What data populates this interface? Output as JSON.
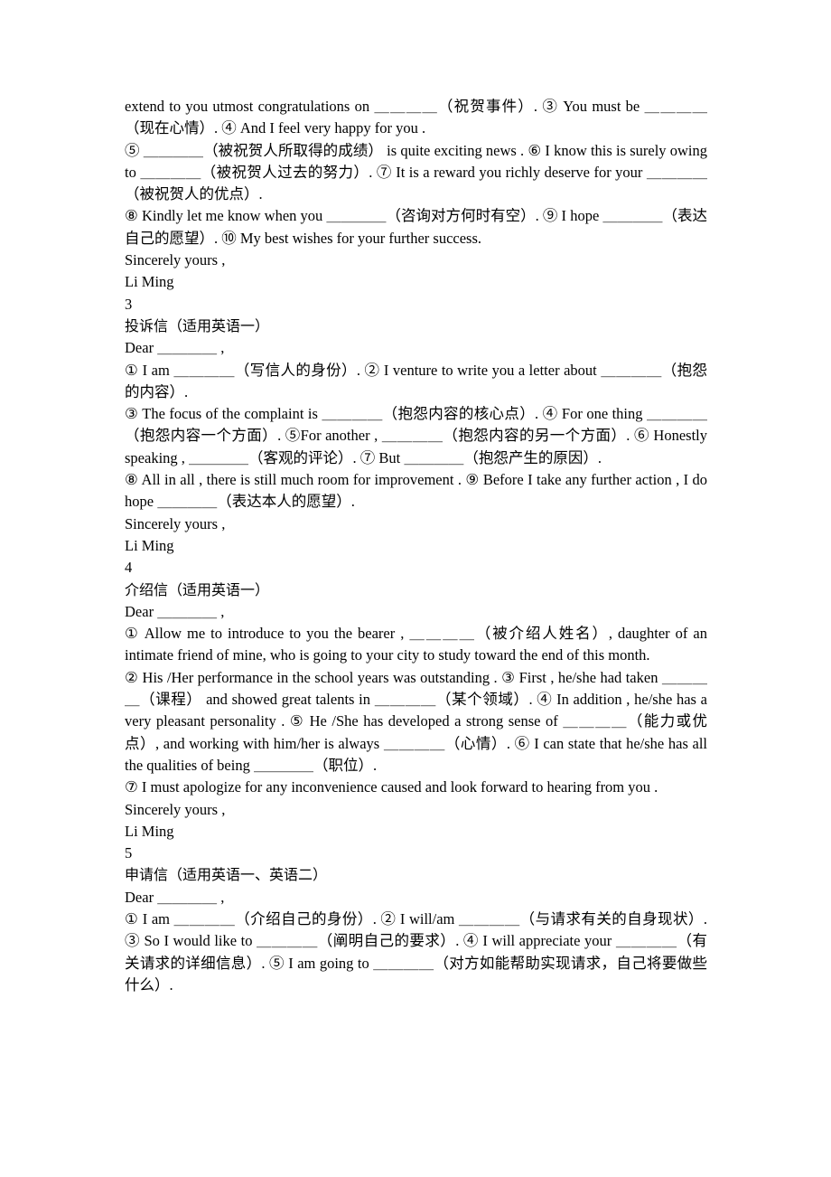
{
  "document": {
    "page_background": "#ffffff",
    "text_color": "#000000",
    "blank": "＿＿＿＿",
    "sections": [
      {
        "id": "congratulation-letter-tail",
        "lines": [
          "extend to you utmost congratulations on ＿＿＿＿（祝贺事件）. ③ You must be ＿＿＿＿（现在心情）. ④ And I feel very happy for you .",
          "⑤ ＿＿＿＿（被祝贺人所取得的成绩） is quite exciting news . ⑥ I know this is surely owing to ＿＿＿＿（被祝贺人过去的努力）. ⑦ It is a reward you richly deserve for your ＿＿＿＿（被祝贺人的优点）.",
          "⑧ Kindly let me know when you ＿＿＿＿（咨询对方何时有空）. ⑨ I hope ＿＿＿＿（表达自己的愿望）. ⑩ My best wishes for your further success."
        ],
        "closing": "Sincerely yours ,",
        "signature": "Li Ming"
      },
      {
        "id": "complaint-letter",
        "number": "3",
        "title": "投诉信（适用英语一）",
        "salutation": "Dear ＿＿＿＿ ,",
        "lines": [
          "① I am ＿＿＿＿（写信人的身份）. ② I venture to write you a letter about ＿＿＿＿（抱怨的内容）.",
          "③ The focus of the complaint is ＿＿＿＿（抱怨内容的核心点）. ④ For one thing ＿＿＿＿（抱怨内容一个方面）. ⑤For another , ＿＿＿＿（抱怨内容的另一个方面）. ⑥ Honestly speaking , ＿＿＿＿（客观的评论）. ⑦ But ＿＿＿＿（抱怨产生的原因）.",
          "⑧ All in all , there is still much room for improvement . ⑨ Before I take any further action , I do hope ＿＿＿＿（表达本人的愿望）."
        ],
        "closing": "Sincerely yours ,",
        "signature": "Li Ming"
      },
      {
        "id": "recommendation-letter",
        "number": "4",
        "title": "介绍信（适用英语一）",
        "salutation": "Dear ＿＿＿＿ ,",
        "lines": [
          "① Allow me to introduce to you the bearer , ＿＿＿＿（被介绍人姓名）, daughter of an intimate friend of mine, who is going to your city to study toward the end of this month.",
          "② His /Her performance in the school years was outstanding . ③ First , he/she had taken ＿＿＿＿（课程） and showed great talents in ＿＿＿＿（某个领域）. ④ In addition , he/she has a very pleasant personality . ⑤ He /She has developed a strong sense of ＿＿＿＿（能力或优点）, and working with him/her is always ＿＿＿＿（心情）. ⑥ I can state that he/she has all the qualities of being ＿＿＿＿（职位）.",
          "⑦ I must apologize for any inconvenience caused and look forward to hearing from you ."
        ],
        "closing": "Sincerely yours ,",
        "signature": "Li Ming"
      },
      {
        "id": "application-letter",
        "number": "5",
        "title": "申请信（适用英语一、英语二）",
        "salutation": "Dear ＿＿＿＿ ,",
        "lines": [
          "① I am ＿＿＿＿（介绍自己的身份）. ② I will/am ＿＿＿＿（与请求有关的自身现状）. ③ So I would like to ＿＿＿＿（阐明自己的要求）. ④ I will appreciate your ＿＿＿＿（有关请求的详细信息）. ⑤ I am going to ＿＿＿＿（对方如能帮助实现请求，自己将要做些什么）."
        ]
      }
    ]
  }
}
